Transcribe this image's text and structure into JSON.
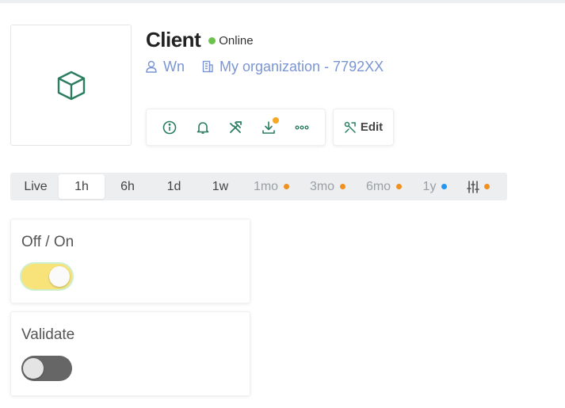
{
  "device": {
    "name": "Client",
    "status": "Online",
    "status_color": "#6cc24a",
    "owner": "Wn",
    "organization": "My organization - 7792XX",
    "icon": "cube-icon"
  },
  "actions": {
    "items": [
      {
        "name": "info-icon"
      },
      {
        "name": "bell-icon"
      },
      {
        "name": "tools-icon"
      },
      {
        "name": "download-icon",
        "badge": true
      },
      {
        "name": "more-icon"
      }
    ],
    "edit_label": "Edit"
  },
  "time_ranges": {
    "selected": "1h",
    "items": [
      {
        "label": "Live"
      },
      {
        "label": "1h"
      },
      {
        "label": "6h"
      },
      {
        "label": "1d"
      },
      {
        "label": "1w"
      },
      {
        "label": "1mo",
        "dot": "#f0901e"
      },
      {
        "label": "3mo",
        "dot": "#f0901e"
      },
      {
        "label": "6mo",
        "dot": "#f0901e"
      },
      {
        "label": "1y",
        "dot": "#2196f3"
      }
    ],
    "filter_dot": "#f0901e"
  },
  "widgets": [
    {
      "label": "Off / On",
      "state": true
    },
    {
      "label": "Validate",
      "state": false
    }
  ],
  "colors": {
    "accent_green": "#2a7d5f",
    "link_blue": "#7a95d6",
    "toggle_on": "#f8e37a",
    "toggle_off": "#666666"
  }
}
